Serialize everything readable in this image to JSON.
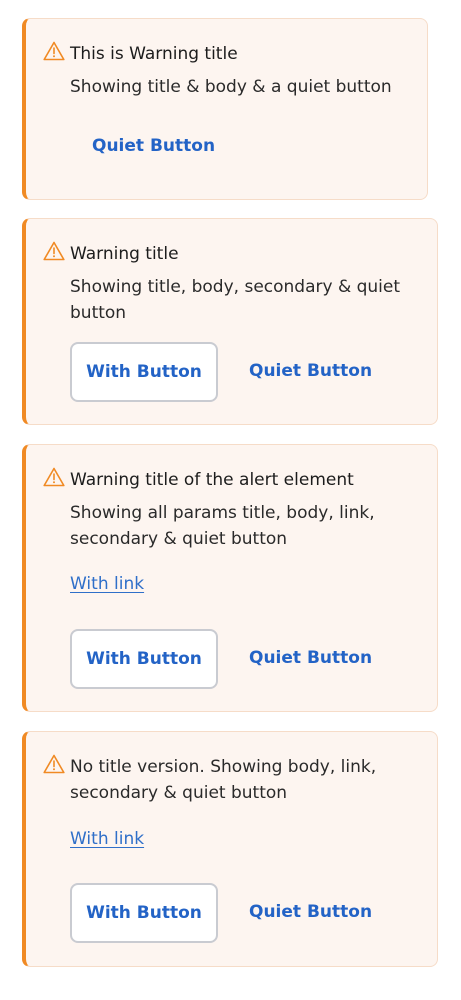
{
  "colors": {
    "accent": "#f08a24",
    "alert_background": "#fdf5f0",
    "link": "#2f6fc9",
    "button_text": "#2363c6"
  },
  "icons": {
    "warning": "warning-triangle-icon"
  },
  "alerts": [
    {
      "title": "This is Warning title",
      "body": "Showing title & body & a quiet button",
      "quiet_button": "Quiet Button"
    },
    {
      "title": "Warning title",
      "body": "Showing title, body, secondary & quiet button",
      "secondary_button": "With Button",
      "quiet_button": "Quiet Button"
    },
    {
      "title": "Warning title of the alert element",
      "body": "Showing all params title, body, link, secondary & quiet button",
      "link": "With link",
      "secondary_button": "With Button",
      "quiet_button": "Quiet Button"
    },
    {
      "body": "No title version. Showing body, link, secondary & quiet button",
      "link": "With link",
      "secondary_button": "With Button",
      "quiet_button": "Quiet Button"
    }
  ]
}
